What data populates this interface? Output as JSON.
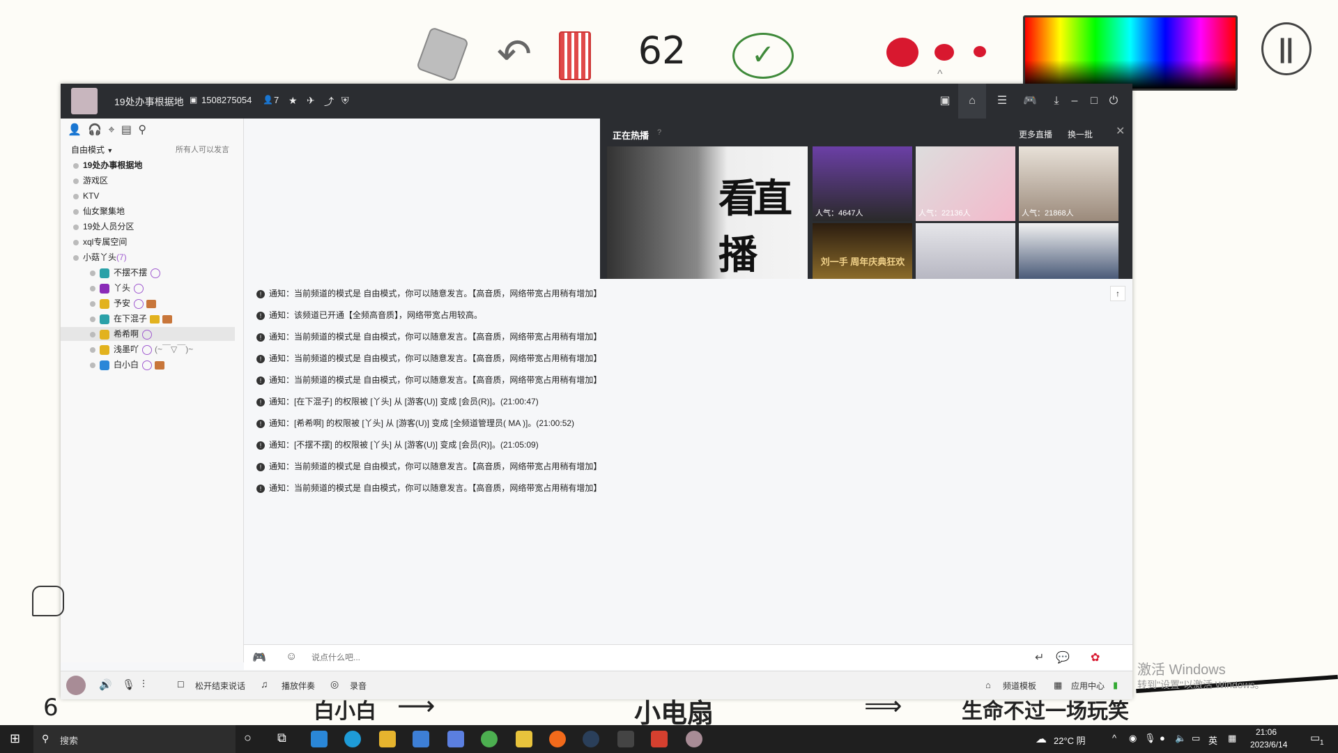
{
  "toolbar": {
    "page_number": "62",
    "colors": {
      "red": "#d8182f"
    }
  },
  "window": {
    "title": "19处办事根据地",
    "channel_id": "1508275054",
    "member_count": "7"
  },
  "left": {
    "mode_label": "自由模式",
    "mode_note": "所有人可以发言",
    "channels": [
      {
        "label": "19处办事根据地"
      },
      {
        "label": "游戏区"
      },
      {
        "label": "KTV"
      },
      {
        "label": "仙女聚集地"
      },
      {
        "label": "19处人员分区"
      },
      {
        "label": "xql专属空间"
      },
      {
        "label": "小菇丫头",
        "count": "(7)"
      }
    ],
    "users": [
      {
        "name": "不摆不摆"
      },
      {
        "name": "丫头"
      },
      {
        "name": "予安"
      },
      {
        "name": "在下混子"
      },
      {
        "name": "希希啊"
      },
      {
        "name": "浅墨吖",
        "suffix": "(~￣▽￣)~"
      },
      {
        "name": "白小白"
      }
    ]
  },
  "hot": {
    "title": "正在热播",
    "more": "更多直播",
    "refresh": "换一批",
    "banner_text": "看直播",
    "thumbs": [
      {
        "pop": "人气：4647人"
      },
      {
        "pop": "人气：22136人"
      },
      {
        "pop": "人气：21868人"
      },
      {
        "pop": ""
      },
      {
        "pop": ""
      },
      {
        "pop": ""
      }
    ],
    "thumb4_caption": "刘一手 周年庆典狂欢"
  },
  "messages": [
    "通知：当前频道的模式是 自由模式，你可以随意发言。【高音质，网络带宽占用稍有增加】",
    "通知：该频道已开通【全频高音质】，网络带宽占用较高。",
    "通知：当前频道的模式是 自由模式，你可以随意发言。【高音质，网络带宽占用稍有增加】",
    "通知：当前频道的模式是 自由模式，你可以随意发言。【高音质，网络带宽占用稍有增加】",
    "通知：当前频道的模式是 自由模式，你可以随意发言。【高音质，网络带宽占用稍有增加】",
    "通知：[在下混子] 的权限被 [丫头] 从 [游客(U)] 变成 [会员(R)]。(21:00:47)",
    "通知：[希希啊] 的权限被 [丫头] 从 [游客(U)] 变成 [全频道管理员( MA )]。(21:00:52)",
    "通知：[不摆不摆] 的权限被 [丫头] 从 [游客(U)] 变成 [会员(R)]。(21:05:09)",
    "通知：当前频道的模式是 自由模式，你可以随意发言。【高音质，网络带宽占用稍有增加】",
    "通知：当前频道的模式是 自由模式，你可以随意发言。【高音质，网络带宽占用稍有增加】"
  ],
  "input": {
    "placeholder": "说点什么吧..."
  },
  "bottom": {
    "release_to_end": "松开结束说话",
    "accompany": "播放伴奏",
    "record": "录音",
    "template": "频道模板",
    "app_center": "应用中心"
  },
  "handwriting": {
    "number": "6",
    "name1": "白小白",
    "name2": "小电扇",
    "slogan": "生命不过一场玩笑"
  },
  "watermark": {
    "line1": "激活 Windows",
    "line2": "转到\"设置\"以激活 Windows。"
  },
  "taskbar": {
    "search": "搜索",
    "weather": "22°C 阴",
    "ime": "英",
    "time": "21:06",
    "date": "2023/6/14",
    "notif_count": "1"
  }
}
